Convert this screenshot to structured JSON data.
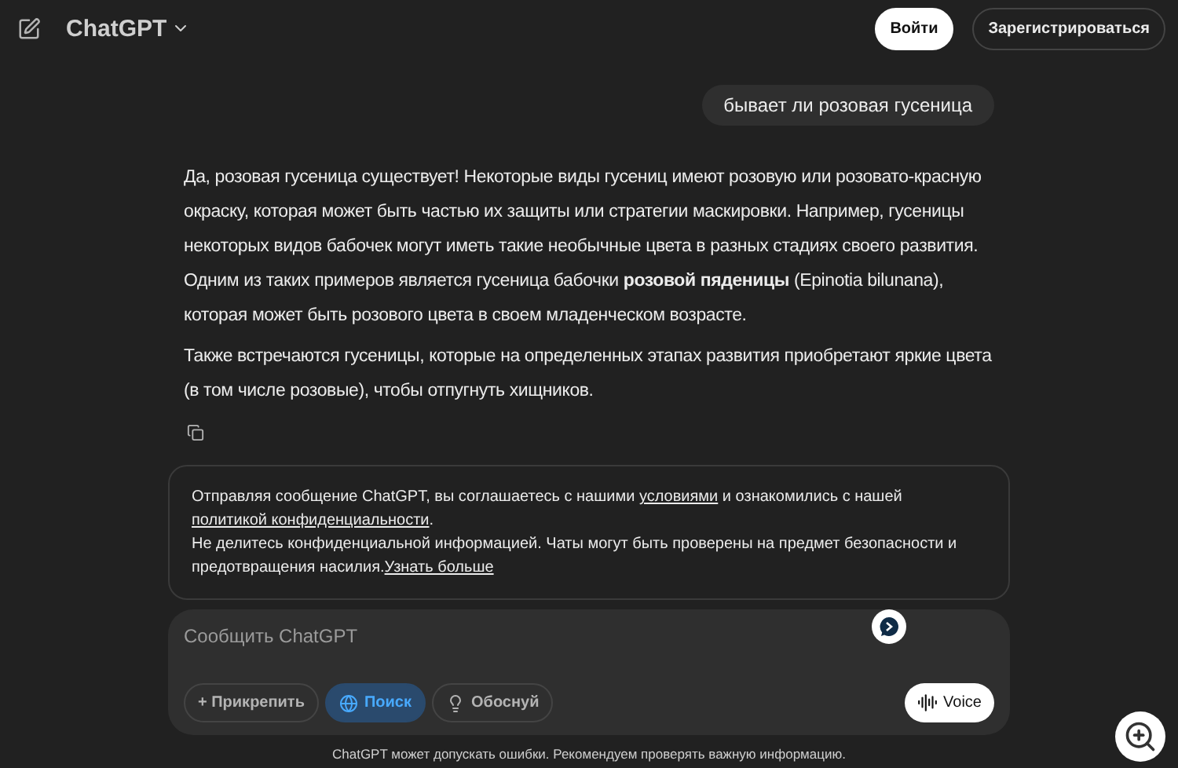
{
  "header": {
    "title": "ChatGPT",
    "buttons": [
      {
        "label": "Войти",
        "kind": "primary"
      },
      {
        "label": "Зарегистрироваться",
        "kind": "outline"
      }
    ]
  },
  "conversation": [
    {
      "kind": "user",
      "paragraphs": [
        "бывает ли розовая гусеница"
      ]
    },
    {
      "kind": "assistant",
      "paragraphs": [
        "Да, розовая гусеница существует! Некоторые виды гусениц имеют розовую или розовато-красную окраску, которая может быть частью их защиты или стратегии маскировки. Например, гусеницы некоторых видов бабочек могут иметь такие необычные цвета в разных стадиях своего развития. Одним из таких примеров является гусеница бабочки **розовой пяденицы** (Epinotia bilunana), которая может быть розового цвета в своем младенческом возрасте.",
        "Также встречаются гусеницы, которые на определенных этапах развития приобретают яркие цвета (в том числе розовые), чтобы отпугнуть хищников."
      ]
    }
  ],
  "notice": {
    "paragraphs": [
      [
        {
          "kind": "text",
          "text": "Отправляя сообщение ChatGPT, вы соглашаетесь с нашими "
        },
        {
          "kind": "link",
          "text": "условиями"
        },
        {
          "kind": "text",
          "text": " и ознакомились с нашей "
        },
        {
          "kind": "link",
          "text": "политикой конфиденциальности"
        },
        {
          "kind": "text",
          "text": "."
        }
      ],
      [
        {
          "kind": "text",
          "text": "Не делитесь конфиденциальной информацией. Чаты могут быть проверены на предмет безопасности и предотвращения насилия."
        },
        {
          "kind": "link",
          "text": "Узнать больше"
        }
      ]
    ]
  },
  "composer": {
    "placeholder": "Сообщить ChatGPT",
    "tools": [
      {
        "label": "+ Прикрепить",
        "kind": "attach",
        "selected": false
      },
      {
        "label": "Поиск",
        "kind": "search",
        "selected": true
      },
      {
        "label": "Обоснуй",
        "kind": "reason",
        "selected": false
      }
    ],
    "voice": "Voice"
  },
  "footer": "ChatGPT может допускать ошибки. Рекомендуем проверять важную информацию."
}
